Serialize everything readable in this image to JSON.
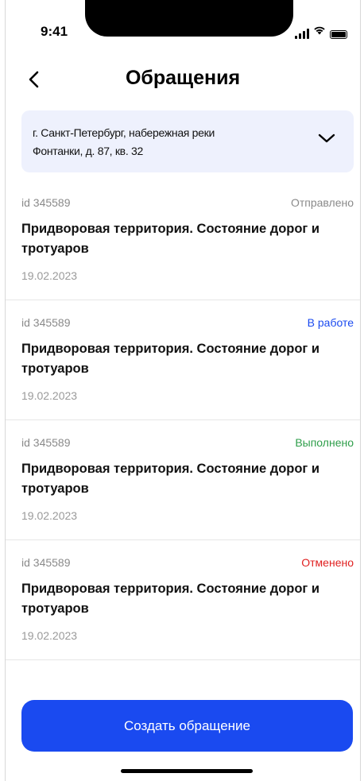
{
  "status_bar": {
    "time": "9:41",
    "icons": [
      "signal-icon",
      "wifi-icon",
      "battery-icon"
    ]
  },
  "header": {
    "title": "Обращения",
    "back_icon": "chevron-left-icon"
  },
  "address": {
    "line1": "г. Санкт-Петербург, набережная реки",
    "line2": "Фонтанки, д. 87, кв. 32",
    "chevron_icon": "chevron-down-icon"
  },
  "requests": [
    {
      "id": "id 345589",
      "status": "Отправлено",
      "status_color": "#8a8a8a",
      "title": "Придворовая территория. Состояние дорог и тротуаров",
      "date": "19.02.2023"
    },
    {
      "id": "id 345589",
      "status": "В работе",
      "status_color": "#1a4af0",
      "title": "Придворовая территория. Состояние дорог и тротуаров",
      "date": "19.02.2023"
    },
    {
      "id": "id 345589",
      "status": "Выполнено",
      "status_color": "#2e9e4a",
      "title": "Придворовая территория. Состояние дорог и тротуаров",
      "date": "19.02.2023"
    },
    {
      "id": "id 345589",
      "status": "Отменено",
      "status_color": "#e02020",
      "title": "Придворовая территория. Состояние дорог и тротуаров",
      "date": "19.02.2023"
    }
  ],
  "create_button": {
    "label": "Создать обращение",
    "color": "#1a4af0"
  }
}
